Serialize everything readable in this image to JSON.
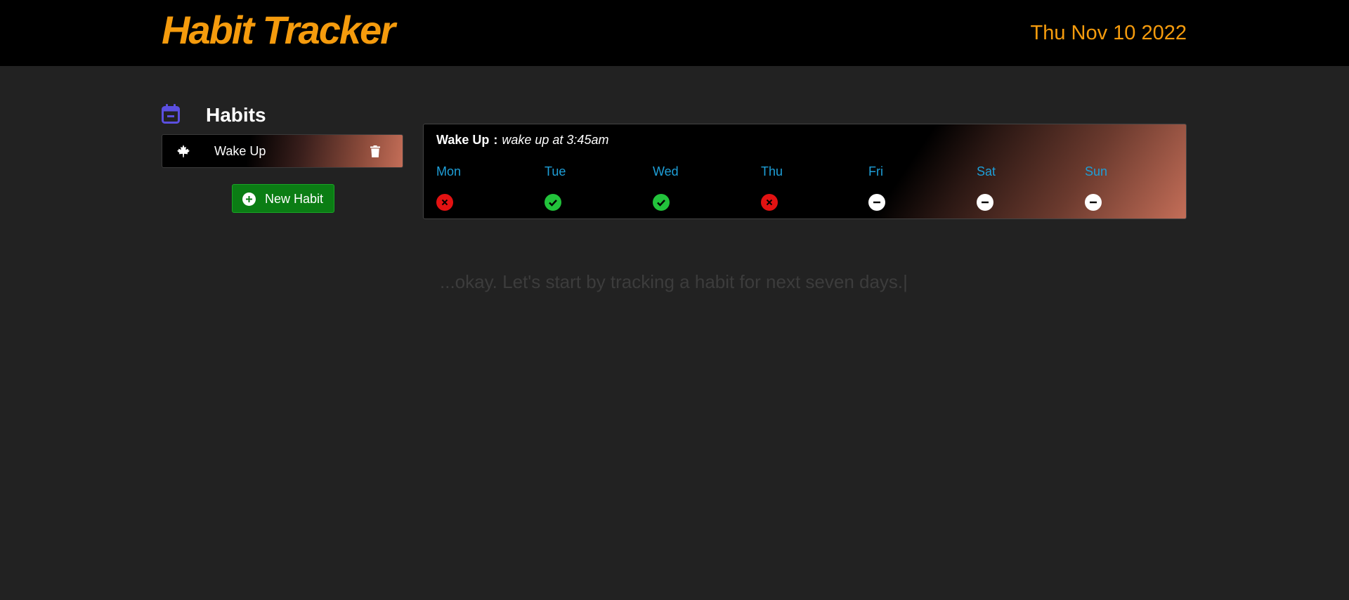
{
  "header": {
    "app_title": "Habit Tracker",
    "date": "Thu Nov 10 2022"
  },
  "sidebar": {
    "title": "Habits",
    "habits": [
      {
        "label": "Wake Up",
        "icon": "maple-leaf-icon"
      }
    ],
    "new_habit_label": "New Habit"
  },
  "habit_card": {
    "name": "Wake Up",
    "separator": ":",
    "description": "wake up at 3:45am",
    "days": [
      {
        "label": "Mon",
        "status": "missed"
      },
      {
        "label": "Tue",
        "status": "done"
      },
      {
        "label": "Wed",
        "status": "done"
      },
      {
        "label": "Thu",
        "status": "missed"
      },
      {
        "label": "Fri",
        "status": "pending"
      },
      {
        "label": "Sat",
        "status": "pending"
      },
      {
        "label": "Sun",
        "status": "pending"
      }
    ]
  },
  "typing_message": "...okay. Let's start by tracking a habit for next seven days.|",
  "colors": {
    "accent": "#f59b0d",
    "day_label": "#1e9fd8",
    "done": "#22c33b",
    "missed": "#e31212",
    "pending": "#ffffff",
    "new_button": "#0b7d14",
    "calendar_icon": "#5b4fe0"
  }
}
